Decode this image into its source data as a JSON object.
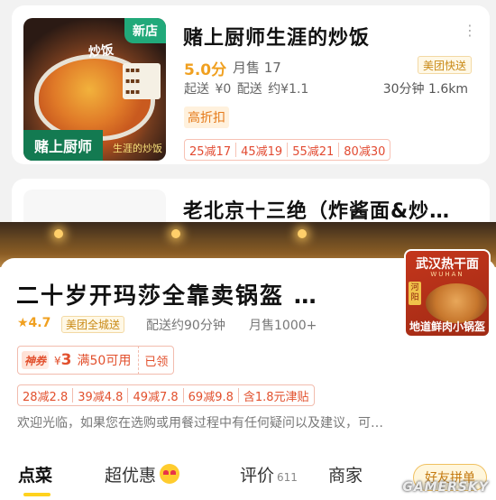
{
  "listing": {
    "card1": {
      "thumb": {
        "corner_badge": "新店",
        "script": "炒饭",
        "sign": "赌上厨师",
        "side_text": "生涯的炒饭"
      },
      "title": "赌上厨师生涯的炒饭",
      "score": "5.0分",
      "monthly_sales": "月售 17",
      "delivery_badge": "美团快送",
      "delivery_info": "起送 ¥0  配送 约¥1.1",
      "time_distance": "30分钟 1.6km",
      "discount_tag": "高折扣",
      "coupons": [
        "25减17",
        "45减19",
        "55减21",
        "80减30"
      ]
    },
    "card2": {
      "title": "老北京十三绝（炸酱面&炒…"
    }
  },
  "store": {
    "title": "二十岁开玛莎全靠卖锅盔 …",
    "rating": "★4.7",
    "delivery_badge": "美团全城送",
    "delivery_time": "配送约90分钟",
    "monthly_sales": "月售1000+",
    "promo_image": {
      "top": "武汉热干面",
      "sub": "WUHAN",
      "side": "河阳",
      "bottom": "地道鲜肉小锅盔"
    },
    "coupon": {
      "tag": "神券",
      "currency": "¥",
      "amount": "3",
      "condition": "满50可用",
      "status": "已领"
    },
    "coupons": [
      "28减2.8",
      "39减4.8",
      "49减7.8",
      "69减9.8",
      "含1.8元津贴"
    ],
    "notice": "欢迎光临，如果您在选购或用餐过程中有任何疑问以及建议，可…",
    "tabs": [
      {
        "label": "点菜"
      },
      {
        "label": "超优惠"
      },
      {
        "label": "评价",
        "count": "611"
      },
      {
        "label": "商家"
      }
    ],
    "tab_pill": "好友拼单",
    "watermark": "GAMERSKY"
  },
  "colors": {
    "accent_orange": "#f0a020",
    "coupon_red": "#e24a31",
    "tab_underline": "#ffd21e"
  }
}
